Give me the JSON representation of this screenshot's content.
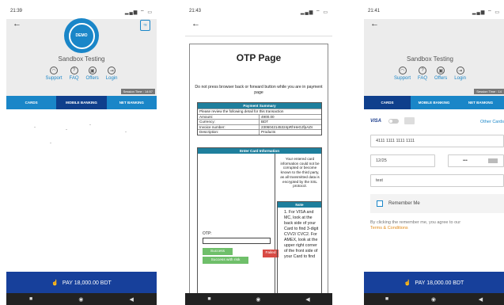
{
  "phone1": {
    "time": "21:39",
    "status_icons": "▂▄▆ ⌔ ▭",
    "logo_text": "DEMO",
    "merchant": "Sandbox Testing",
    "links": [
      {
        "label": "Support",
        "icon": "headset-icon"
      },
      {
        "label": "FAQ",
        "icon": "question-icon"
      },
      {
        "label": "Offers",
        "icon": "gift-icon"
      },
      {
        "label": "Login",
        "icon": "login-icon"
      }
    ],
    "session": "Session Time : 14:57",
    "tabs": [
      "CARDS",
      "MOBILE BANKING",
      "NET BANKING"
    ],
    "pay_label": "PAY 18,000.00 BDT"
  },
  "phone2": {
    "time": "21:43",
    "status_icons": "▂▄▆ ⌔ ▭",
    "title": "OTP Page",
    "warning": "Do not press browser back or forward button while you are in payment page",
    "summary_title": "Payment Summary",
    "summary_intro": "Please review the following detail for this transaction",
    "summary_rows": [
      {
        "k": "Amount:",
        "v": "4900.00"
      },
      {
        "k": "Currency:",
        "v": "BDT"
      },
      {
        "k": "Invoice number:",
        "v": "2306042145324pRhHeGJfpAZs"
      },
      {
        "k": "Description:",
        "v": "Products"
      }
    ],
    "card_info_title": "Enter Card Information",
    "security_text": "Your entered card information could not be corrupted or become known to the third party, as all transmitted data is encrypted by the SSL protocol.",
    "otp_label": "OTP:",
    "btn_success": "Success",
    "btn_success_risk": "Success with risk",
    "btn_failed": "Failed",
    "note_title": "Note",
    "note_text": "1. For VISA and MC, look at the back side of your Card to find 3-digit CVV2/ CVC2. For AMEX, look at the upper right corner of the front side of your Card to find"
  },
  "phone3": {
    "time": "21:41",
    "status_icons": "▂▄▆ ⌔ ▭",
    "merchant": "Sandbox Testing",
    "links": [
      {
        "label": "Support",
        "icon": "headset-icon"
      },
      {
        "label": "FAQ",
        "icon": "question-icon"
      },
      {
        "label": "Offers",
        "icon": "gift-icon"
      },
      {
        "label": "Login",
        "icon": "login-icon"
      }
    ],
    "session": "Session Time : 14",
    "tabs": [
      "CARDS",
      "MOBILE BANKING",
      "NET BANKING"
    ],
    "visa_label": "VISA",
    "other_cards": "Other Cards",
    "card_number": "4111 1111 1111 1111",
    "expiry": "12/25",
    "cvv": "•••",
    "name": "test",
    "remember": "Remember Me",
    "terms_prefix": "By clicking the remember me, you agree to our",
    "terms_link": "Terms & Conditions",
    "pay_label": "PAY 18,000.00 BDT"
  },
  "navbar": {
    "square": "■",
    "home": "◉",
    "back": "◀"
  },
  "colors": {
    "primary": "#1a86c8",
    "dark_tab": "#0f3f8c",
    "pay": "#17409b",
    "table_head": "#1e7f9d",
    "success": "#6fbf6a",
    "failed": "#d84a44",
    "terms": "#e08a1a"
  }
}
